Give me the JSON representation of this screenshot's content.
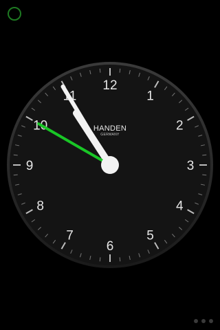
{
  "clock": {
    "brand": "HANDEN",
    "brand_sub": "GERMANY",
    "numerals": [
      "12",
      "1",
      "2",
      "3",
      "4",
      "5",
      "6",
      "7",
      "8",
      "9",
      "10",
      "11"
    ],
    "time": {
      "hour": 10,
      "minute": 54,
      "second": 50
    },
    "colors": {
      "face": "#141414",
      "bezel": "#2a2a2a",
      "hands": "#f2f2f2",
      "second_hand": "#19c626",
      "status_ring": "#1e7a22"
    }
  },
  "status_indicator": {
    "icon": "circle-ring-icon"
  },
  "page_indicator": {
    "count": 3,
    "active_index": 0
  }
}
